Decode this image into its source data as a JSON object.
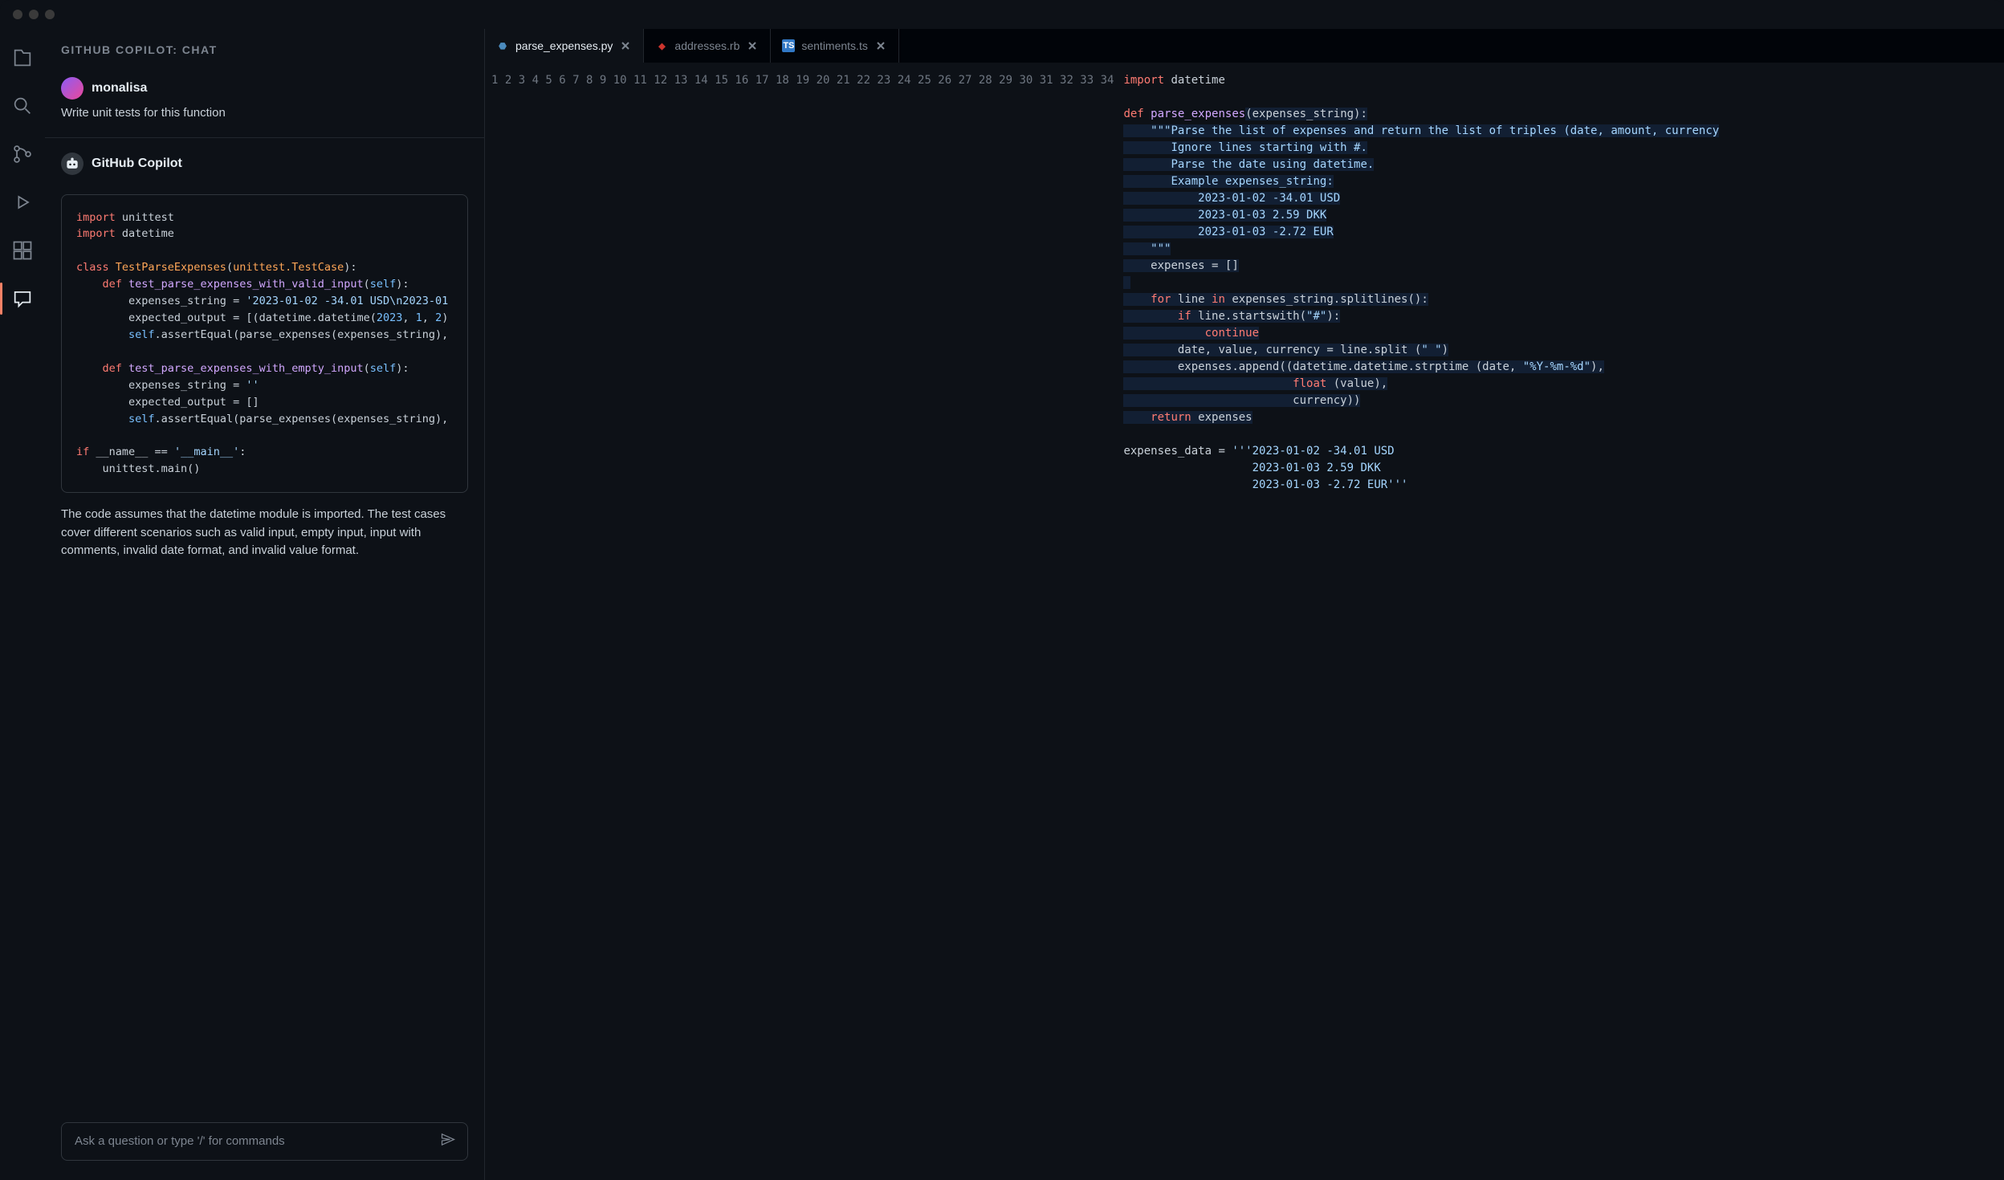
{
  "chat": {
    "header": "GITHUB COPILOT: CHAT",
    "user": "monalisa",
    "prompt": "Write unit tests for this function",
    "agent": "GitHub Copilot",
    "explanation": "The code assumes that the datetime module is imported. The test cases cover different scenarios such as valid input, empty input, input with comments, invalid date format, and invalid value format.",
    "placeholder": "Ask a question or type '/' for commands",
    "code": {
      "l1a": "import",
      "l1b": " unittest",
      "l2a": "import",
      "l2b": " datetime",
      "l4a": "class",
      "l4b": " TestParseExpenses",
      "l4c": "(",
      "l4d": "unittest.TestCase",
      "l4e": "):",
      "l5a": "    def",
      "l5b": " test_parse_expenses_with_valid_input",
      "l5c": "(",
      "l5d": "self",
      "l5e": "):",
      "l6a": "        expenses_string = ",
      "l6b": "'2023-01-02 -34.01 USD\\n2023-01",
      "l7a": "        expected_output = [(datetime.datetime(",
      "l7b": "2023",
      "l7c": ", ",
      "l7d": "1",
      "l7e": ", ",
      "l7f": "2",
      "l7g": ")",
      "l8a": "        ",
      "l8b": "self",
      "l8c": ".assertEqual(parse_expenses(expenses_string),",
      "l10a": "    def",
      "l10b": " test_parse_expenses_with_empty_input",
      "l10c": "(",
      "l10d": "self",
      "l10e": "):",
      "l11a": "        expenses_string = ",
      "l11b": "''",
      "l12": "        expected_output = []",
      "l13a": "        ",
      "l13b": "self",
      "l13c": ".assertEqual(parse_expenses(expenses_string),",
      "l15a": "if",
      "l15b": " __name__ == ",
      "l15c": "'__main__'",
      "l15d": ":",
      "l16": "    unittest.main()"
    }
  },
  "tabs": [
    {
      "label": "parse_expenses.py",
      "type": "py",
      "active": true
    },
    {
      "label": "addresses.rb",
      "type": "rb",
      "active": false
    },
    {
      "label": "sentiments.ts",
      "type": "ts",
      "active": false
    }
  ],
  "editor": {
    "line_count": 34,
    "code": {
      "l1": "import datetime",
      "l3a": "def",
      "l3b": " parse_expenses",
      "l3c": "(expenses_string):",
      "l4": "    \"\"\"Parse the list of expenses and return the list of triples (date, amount, currency",
      "l5": "       Ignore lines starting with #.",
      "l6": "       Parse the date using datetime.",
      "l7": "       Example expenses_string:",
      "l8": "           2023-01-02 -34.01 USD",
      "l9": "           2023-01-03 2.59 DKK",
      "l10": "           2023-01-03 -2.72 EUR",
      "l11": "    \"\"\"",
      "l12": "    expenses = []",
      "l14a": "    for",
      "l14b": " line ",
      "l14c": "in",
      "l14d": " expenses_string.splitlines():",
      "l15a": "        if",
      "l15b": " line.startswith(",
      "l15c": "\"#\"",
      "l15d": "):",
      "l16a": "            continue",
      "l17a": "        date, value, currency = line.split (",
      "l17b": "\" \"",
      "l17c": ")",
      "l18a": "        expenses.append((datetime.datetime.strptime (date, ",
      "l18b": "\"%Y-%m-%d\"",
      "l18c": "),",
      "l19a": "                         float",
      "l19b": " (value),",
      "l20": "                         currency))",
      "l21a": "    return",
      "l21b": " expenses",
      "l23a": "expenses_data = ",
      "l23b": "'''2023-01-02 -34.01 USD",
      "l24": "                   2023-01-03 2.59 DKK",
      "l25": "                   2023-01-03 -2.72 EUR'''"
    }
  }
}
